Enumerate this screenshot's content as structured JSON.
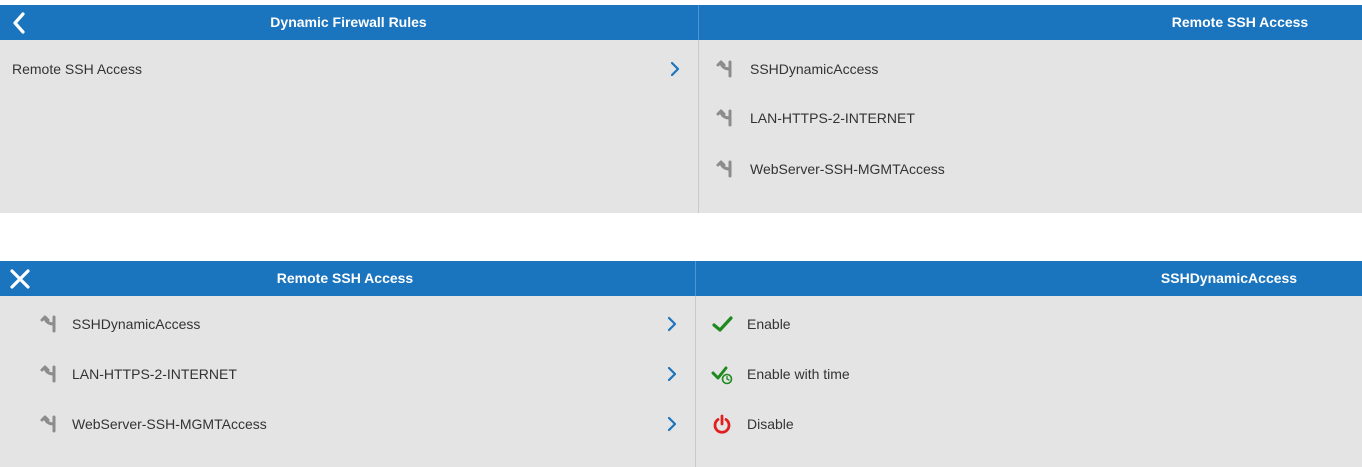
{
  "top": {
    "header": {
      "left_title": "Dynamic Firewall Rules",
      "right_title": "Remote SSH Access",
      "button_icon": "back-arrow-icon"
    },
    "left_items": [
      {
        "label": "Remote SSH Access"
      }
    ],
    "right_items": [
      {
        "label": "SSHDynamicAccess",
        "icon": "rule-fork-icon"
      },
      {
        "label": "LAN-HTTPS-2-INTERNET",
        "icon": "rule-fork-icon"
      },
      {
        "label": "WebServer-SSH-MGMTAccess",
        "icon": "rule-fork-icon"
      }
    ]
  },
  "bottom": {
    "header": {
      "left_title": "Remote SSH Access",
      "right_title": "SSHDynamicAccess",
      "button_icon": "close-icon"
    },
    "left_items": [
      {
        "label": "SSHDynamicAccess",
        "icon": "rule-fork-icon"
      },
      {
        "label": "LAN-HTTPS-2-INTERNET",
        "icon": "rule-fork-icon"
      },
      {
        "label": "WebServer-SSH-MGMTAccess",
        "icon": "rule-fork-icon"
      }
    ],
    "right_items": [
      {
        "label": "Enable",
        "icon": "checkmark-icon"
      },
      {
        "label": "Enable with time",
        "icon": "checkmark-clock-icon"
      },
      {
        "label": "Disable",
        "icon": "power-icon"
      }
    ]
  },
  "colors": {
    "header_blue": "#1a74be",
    "panel_gray": "#e4e4e4",
    "chevron_blue": "#1a74be",
    "icon_gray": "#8c8c8c",
    "check_green": "#1e8a1e",
    "power_red": "#e02020"
  }
}
